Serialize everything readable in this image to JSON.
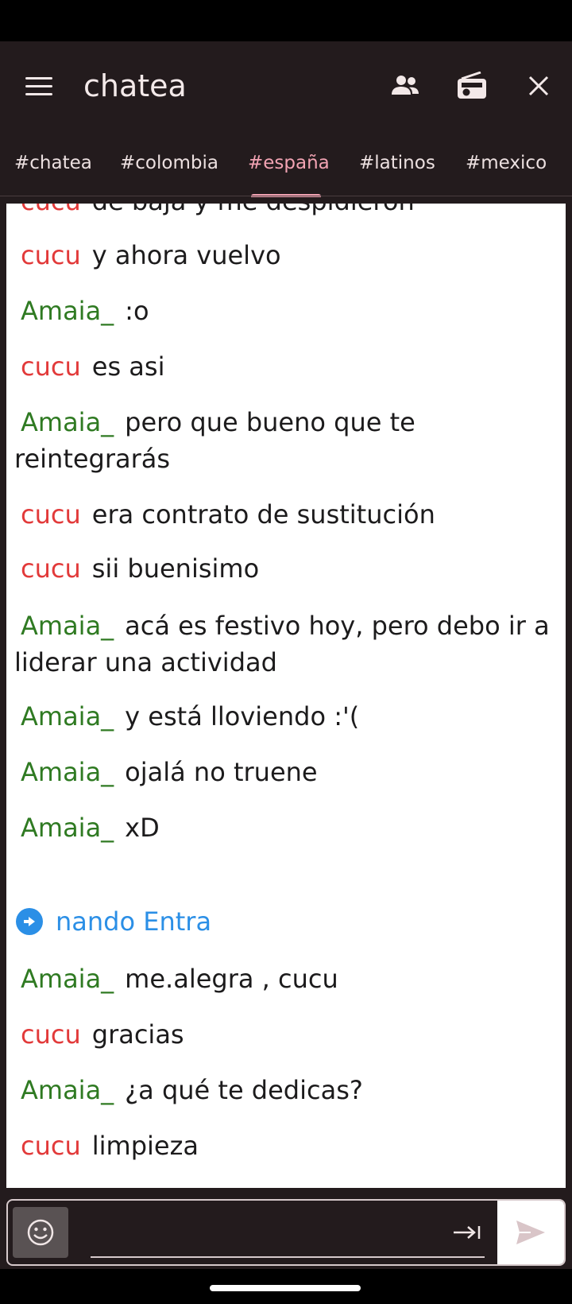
{
  "app": {
    "title": "chatea"
  },
  "tabs": [
    {
      "label": "#chatea",
      "active": false
    },
    {
      "label": "#colombia",
      "active": false
    },
    {
      "label": "#españa",
      "active": true
    },
    {
      "label": "#latinos",
      "active": false
    },
    {
      "label": "#mexico",
      "active": false
    }
  ],
  "colors": {
    "background": "#231b1d",
    "accent": "#f2a3b3",
    "nick_red": "#e23a3a",
    "nick_green": "#2f7a22",
    "join_blue": "#2b8fe6"
  },
  "messages": [
    {
      "nick": "cucu",
      "text": "de baja y me despidieron",
      "color": "red"
    },
    {
      "nick": "cucu",
      "text": "y ahora vuelvo",
      "color": "red"
    },
    {
      "nick": "Amaia_",
      "text": ":o",
      "color": "green"
    },
    {
      "nick": "cucu",
      "text": "es asi",
      "color": "red"
    },
    {
      "nick": "Amaia_",
      "text": "pero que bueno que te reintegrarás",
      "color": "green"
    },
    {
      "nick": "cucu",
      "text": "era contrato de sustitución",
      "color": "red"
    },
    {
      "nick": "cucu",
      "text": "sii buenisimo",
      "color": "red"
    },
    {
      "nick": "Amaia_",
      "text": "acá es festivo hoy, pero debo ir a liderar una actividad",
      "color": "green"
    },
    {
      "nick": "Amaia_",
      "text": "y está lloviendo :'(",
      "color": "green"
    },
    {
      "nick": "Amaia_",
      "text": "ojalá no truene",
      "color": "green"
    },
    {
      "nick": "Amaia_",
      "text": "xD",
      "color": "green"
    },
    {
      "nick": "Amaia_",
      "text": "me.alegra , cucu",
      "color": "green"
    },
    {
      "nick": "cucu",
      "text": "gracias",
      "color": "red"
    },
    {
      "nick": "Amaia_",
      "text": "¿a qué te dedicas?",
      "color": "green"
    },
    {
      "nick": "cucu",
      "text": "limpieza",
      "color": "red"
    }
  ],
  "join_event": {
    "nick": "nando",
    "action": "Entra"
  },
  "composer": {
    "value": "",
    "placeholder": ""
  },
  "icons": {
    "menu": "menu-icon",
    "users": "users-icon",
    "radio": "radio-icon",
    "close": "close-icon",
    "emoji": "emoji-icon",
    "tab_key": "tab-key-icon",
    "send": "send-icon",
    "join": "join-arrow-icon"
  }
}
